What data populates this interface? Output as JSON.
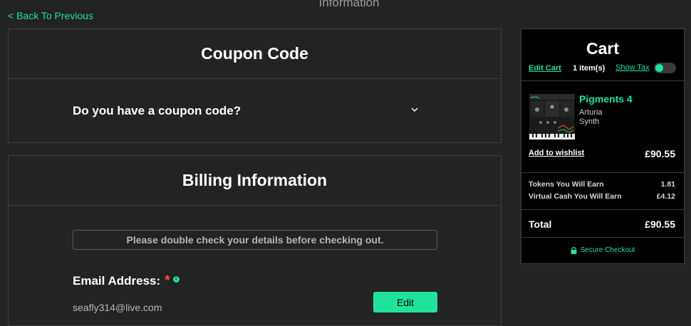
{
  "page": {
    "heading": "Information",
    "back_label": "< Back To Previous"
  },
  "coupon": {
    "title": "Coupon Code",
    "question": "Do you have a coupon code?"
  },
  "billing": {
    "title": "Billing Information",
    "notice": "Please double check your details before checking out.",
    "email_label": "Email Address:",
    "required_mark": "*",
    "info_mark": "i",
    "email_value": "seafly314@live.com",
    "edit_label": "Edit"
  },
  "cart": {
    "title": "Cart",
    "edit_label": "Edit Cart",
    "item_count": "1 item(s)",
    "show_tax_label": "Show Tax",
    "show_tax_on": true,
    "product": {
      "name": "Pigments 4",
      "brand": "Arturia",
      "type": "Synth",
      "price": "£90.55",
      "wishlist_label": "Add to wishlist"
    },
    "tokens_label": "Tokens You Will Earn",
    "tokens_value": "1.81",
    "virtual_cash_label": "Virtual Cash You Will Earn",
    "virtual_cash_value": "£4.12",
    "total_label": "Total",
    "total_value": "£90.55",
    "secure_label": "Secure Checkout"
  },
  "colors": {
    "accent": "#1fe39b",
    "background": "#232323",
    "cart_bg": "#000000",
    "required": "#ff4d3a"
  },
  "icons": {
    "chevron": "chevron-down-icon",
    "lock": "lock-icon",
    "info": "info-icon"
  }
}
